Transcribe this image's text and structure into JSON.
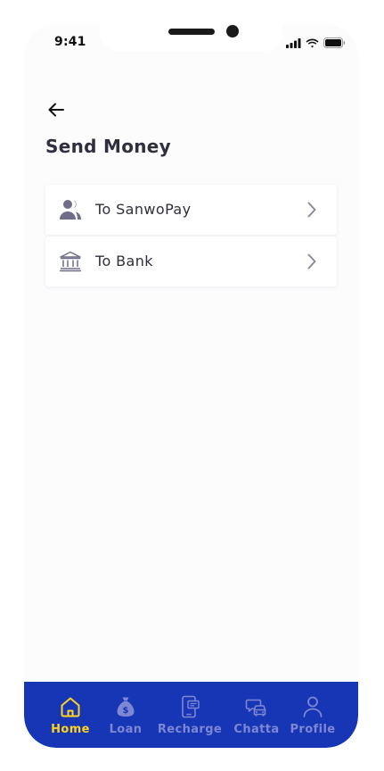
{
  "status_bar": {
    "time": "9:41"
  },
  "header": {
    "title": "Send Money"
  },
  "options": [
    {
      "label": "To SanwoPay",
      "icon": "users-icon"
    },
    {
      "label": "To Bank",
      "icon": "bank-icon"
    }
  ],
  "nav": {
    "active": "Home",
    "items": [
      {
        "label": "Home",
        "icon": "home-icon"
      },
      {
        "label": "Loan",
        "icon": "money-bag-icon"
      },
      {
        "label": "Recharge",
        "icon": "phone-recharge-icon"
      },
      {
        "label": "Chatta",
        "icon": "chat-car-icon"
      },
      {
        "label": "Profile",
        "icon": "user-icon"
      }
    ]
  },
  "colors": {
    "nav_background": "#1736b5",
    "nav_active": "#ffd21f",
    "nav_inactive": "#7d87d4",
    "text_primary": "#2f2f3d",
    "icon_muted": "#6e6e89"
  }
}
